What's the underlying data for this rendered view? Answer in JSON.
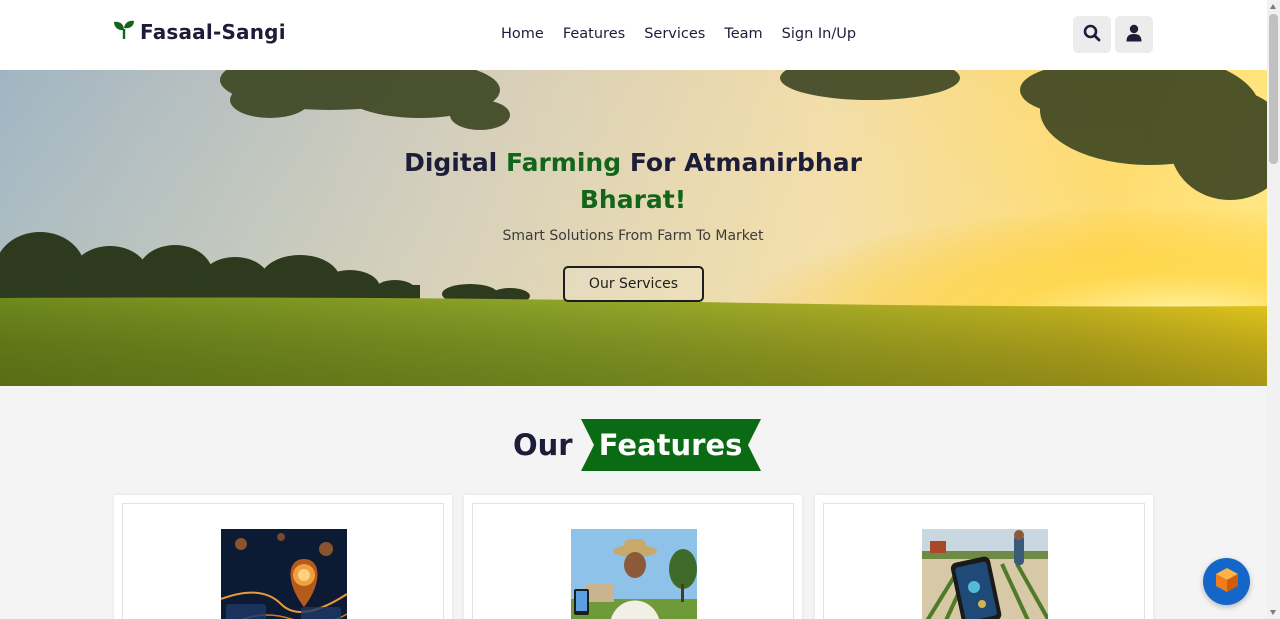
{
  "brand": {
    "name": "Fasaal-Sangi",
    "logo_icon": "sprout-icon",
    "color": "#12661a"
  },
  "nav": [
    "Home",
    "Features",
    "Services",
    "Team",
    "Sign In/Up"
  ],
  "header_actions": {
    "search_icon": "search-icon",
    "user_icon": "user-icon"
  },
  "hero": {
    "title_part1": "Digital",
    "title_green1": "Farming",
    "title_part2": "For Atmanirbhar",
    "title_green2": "Bharat!",
    "subtitle": "Smart Solutions From Farm To Market",
    "button_label": "Our Services"
  },
  "features": {
    "heading_plain": "Our",
    "heading_badge": "Features",
    "badge_color": "#0b6a14",
    "cards": [
      {
        "image_icon": "gps-location-pin-image"
      },
      {
        "image_icon": "farmer-with-phone-image"
      },
      {
        "image_icon": "smart-farming-phone-image"
      }
    ]
  },
  "floating_button": {
    "icon": "cube-icon",
    "color": "#1467c9"
  }
}
